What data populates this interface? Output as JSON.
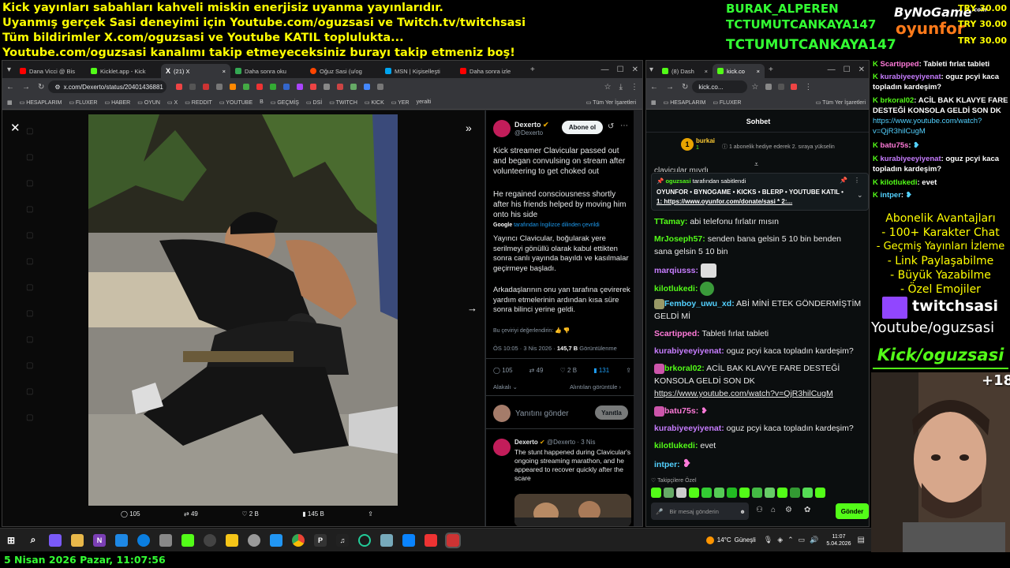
{
  "overlay": {
    "lines": [
      "Kick yayınları sabahları kahveli miskin enerjisiz uyanma yayınlarıdır.",
      "Uyanmış gerçek Sasi deneyimi için Youtube.com/oguzsasi ve Twitch.tv/twitchsasi",
      "Tüm bildirimler X.com/oguzsasi ve Youtube KATIL topluluktа...",
      "Youtube.com/oguzsasi kanalımı takip etmeyeceksiniz burayı takip etmeniz boş!"
    ],
    "donors": [
      "BURAK_ALPEREN",
      "TCTUMUTCANKAYA147",
      "TCTUMUTCANKAYA147"
    ],
    "sponsor_top": "ByNoGame",
    "sponsor_small": ".com",
    "sponsor_bottom": "oyunfor",
    "try": [
      "TRY 30.00",
      "TRY 30.00",
      "TRY 30.00"
    ],
    "datetime": "5 Nisan 2026 Pazar, 11:07:56",
    "benefits_title": "Abonelik Avantajları",
    "benefits": [
      "- 100+ Karakter Chat",
      "- Geçmiş Yayınları İzleme",
      "- Link Paylaşabilme",
      "- Büyük Yazabilme",
      "- Özel Emojiler"
    ],
    "twitch_name": "twitchsasi",
    "youtube_name": "Youtube/oguzsasi",
    "kick_name": "Kick/oguzsasi",
    "cam_badge": "+18"
  },
  "browser_left": {
    "tabs": [
      {
        "label": "Dana Vicci @ Bis",
        "color": "#ff0000"
      },
      {
        "label": "Kicklet.app - Kick",
        "color": "#53fc18"
      },
      {
        "label": "(21) X",
        "color": "#ffffff",
        "active": true
      },
      {
        "label": "Daha sonra oku",
        "color": "#34a853"
      },
      {
        "label": "Oğuz Sasi (u/og",
        "color": "#ff4500"
      },
      {
        "label": "MSN | Kişiselleşti",
        "color": "#00a4ef"
      },
      {
        "label": "Daha sonra izle",
        "color": "#ff0000"
      }
    ],
    "url": "x.com/Dexerto/status/20401436881",
    "bookmarks": [
      "HESAPLARIM",
      "FLUXER",
      "HABER",
      "OYUN",
      "X",
      "REDDIT",
      "YOUTUBE",
      "B",
      "GEÇMİŞ",
      "DSİ",
      "TWITCH",
      "KICK",
      "YER",
      "yeralti"
    ],
    "bookmarks_right": "Tüm Yer İşaretleri",
    "stats_bar": {
      "replies": "105",
      "reposts": "49",
      "likes": "2 B",
      "views": "145 B"
    }
  },
  "tweet": {
    "name": "Dexerto",
    "handle": "@Dexerto",
    "follow": "Abone ol",
    "text_en_1": "Kick streamer Clavicular passed out and began convulsing on stream after volunteering to get choked out",
    "text_en_2": "He regained consciousness shortly after his friends helped by moving him onto his side",
    "google": "Google",
    "translated_note": "tarafından İngilizce dilinden çevrildi",
    "text_tr_1": "Yayıncı Clavicular, boğularak yere serilmeyi gönüllü olarak kabul ettikten sonra canlı yayında bayıldı ve kasılmalar geçirmeye başladı.",
    "text_tr_2": "Arkadaşlarının onu yan tarafına çevirerek yardım etmelerinin ardından kısa süre sonra bilinci yerine geldi.",
    "rate": "Bu çeviriyi değerlendirin:",
    "time": "ÖS 10:05 · 3 Nis 2026 ·",
    "views": "145,7 B",
    "views_label": "Görüntülenme",
    "replies": "105",
    "reposts": "49",
    "likes": "2 B",
    "bookmarks": "131",
    "related_left": "Alakalı",
    "related_right": "Alıntılan görüntüle",
    "reply_placeholder": "Yanıtını gönder",
    "reply_button": "Yanıtla",
    "thread_name": "Dexerto",
    "thread_handle": "@Dexerto · 3 Nis",
    "thread_text": "The stunt happened during Clavicular's ongoing streaming marathon, and he appeared to recover quickly after the scare"
  },
  "browser_right": {
    "tabs": [
      {
        "label": "(8) Dash",
        "color": "#53fc18"
      },
      {
        "label": "kick.co",
        "color": "#53fc18",
        "active": true
      }
    ],
    "url": "kick.co...",
    "bookmarks": [
      "HESAPLARIM",
      "FLUXER"
    ],
    "bookmarks_right": "Tüm Yer İşaretleri"
  },
  "kick_chat": {
    "title": "Sohbet",
    "gift_user": "burkai",
    "gift_count": "1",
    "gift_text": "1 abonelik hediye ederek 2. sıraya yükselin",
    "cut_text": "clavicular mıydı",
    "pinned_by": "oguzsasi",
    "pinned_label": "tarafından sabitlendi",
    "pinned_text": "OYUNFOR • BYNOGAME • KICKS • BLERP • YOUTUBE KATIL •",
    "pinned_link": "1: https://www.oyunfor.com/donate/sasi * 2:...",
    "messages": [
      {
        "user": "TTamay",
        "text": "abi telefonu fırlatır mısın",
        "cls": "u-green"
      },
      {
        "user": "MrJoseph57",
        "text": "senden bana gelsin 5 10 bin benden",
        "cls": "u-green",
        "cont": "sana gelsin 5 10 bin"
      },
      {
        "user": "marqiusss",
        "text": "",
        "cls": "u-mag"
      },
      {
        "user": "kilotlukedi",
        "text": "",
        "cls": "u-green"
      },
      {
        "user": "Femboy_uwu_xd",
        "text": "ABİ MİNİ ETEK GÖNDERMİŞTİM",
        "cls": "u-cyan",
        "cont": "GELDİ Mİ"
      },
      {
        "user": "Scartipped",
        "text": "Tableti fırlat tableti",
        "cls": "u-pink"
      },
      {
        "user": "kurabiyeeyiyenat",
        "text": "oguz pcyi kaca topladın kardeşim?",
        "cls": "u-mag"
      },
      {
        "user": "brkoral02",
        "text": "ACİL BAK KLAVYE FARE DESTEĞİ",
        "cls": "u-green",
        "cont": "KONSOLA GELDİ SON DK",
        "link": "https://www.youtube.com/watch?v=QjR3hilCugM"
      },
      {
        "user": "batu75s",
        "text": "",
        "cls": "u-pink"
      },
      {
        "user": "kurabiyeeyiyenat",
        "text": "oguz pcyi kaca topladın kardeşim?",
        "cls": "u-mag"
      },
      {
        "user": "kilotlukedi",
        "text": "evet",
        "cls": "u-green"
      },
      {
        "user": "intper",
        "text": "",
        "cls": "u-cyan"
      }
    ],
    "followers_label": "Takipçilere Özel",
    "input_placeholder": "Bir mesaj gönderin",
    "send": "Gönder"
  },
  "side_chat": [
    {
      "user": "Scartipped",
      "text": ": Tableti fırlat tableti",
      "color": "#ff7ad9"
    },
    {
      "user": "kurabiyeeyiyenat",
      "text": ": oguz pcyi kaca",
      "color": "#c77dff",
      "cont": "topladın kardeşim?"
    },
    {
      "user": "brkoral02",
      "text": ": ACİL BAK KLAVYE FARE",
      "color": "#53fc18",
      "cont": "DESTEĞİ KONSOLA GELDİ SON DK",
      "cont2": "https://www.youtube.com/watch?",
      "cont3": "v=QjR3hilCugM"
    },
    {
      "user": "batu75s",
      "text": ":",
      "color": "#ff7ad9"
    },
    {
      "user": "kurabiyeeyiyenat",
      "text": ": oguz pcyi kaca",
      "color": "#c77dff",
      "cont": "topladın kardeşim?"
    },
    {
      "user": "kilotlukedi",
      "text": ": evet",
      "color": "#53fc18"
    },
    {
      "user": "intper",
      "text": ":",
      "color": "#53d1ff"
    }
  ],
  "taskbar": {
    "weather": "14°C",
    "weather_label": "Güneşli",
    "time": "11:07",
    "date": "5.04.2026"
  }
}
